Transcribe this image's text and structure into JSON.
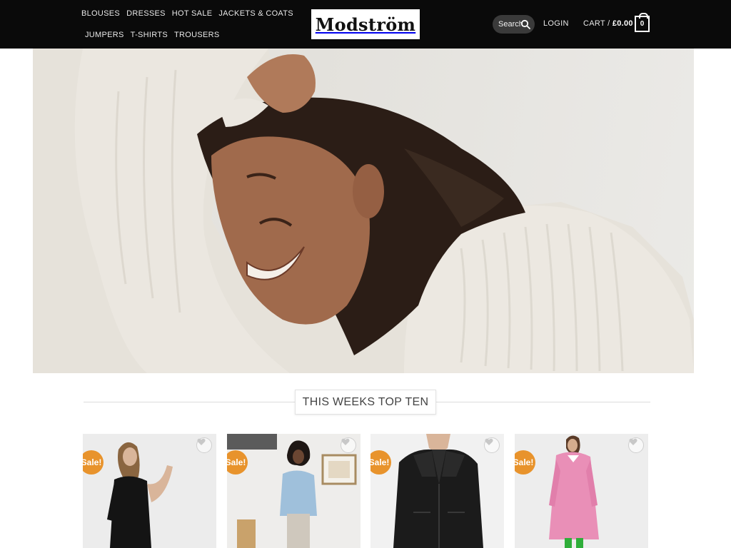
{
  "header": {
    "nav_row1": [
      "BLOUSES",
      "DRESSES",
      "HOT SALE",
      "JACKETS & COATS"
    ],
    "nav_row2": [
      "JUMPERS",
      "T-SHIRTS",
      "TROUSERS"
    ],
    "logo_text": "Modström",
    "search_label": "Search",
    "login_label": "LOGIN",
    "cart_label": "CART /",
    "cart_total": "£0.00",
    "cart_count": "0"
  },
  "section": {
    "title": "THIS WEEKS TOP TEN"
  },
  "products": [
    {
      "badge": "Sale!",
      "image": "woman-black-dress"
    },
    {
      "badge": "Sale!",
      "image": "woman-light-blue-blazer"
    },
    {
      "badge": "Sale!",
      "image": "black-leather-jacket"
    },
    {
      "badge": "Sale!",
      "image": "woman-pink-coat"
    }
  ],
  "icons": {
    "search": "search-icon",
    "wishlist": "heart-icon",
    "cart": "cart-bag-icon"
  },
  "colors": {
    "header_bg": "#0a0a0a",
    "sale_badge": "#e8932c"
  }
}
